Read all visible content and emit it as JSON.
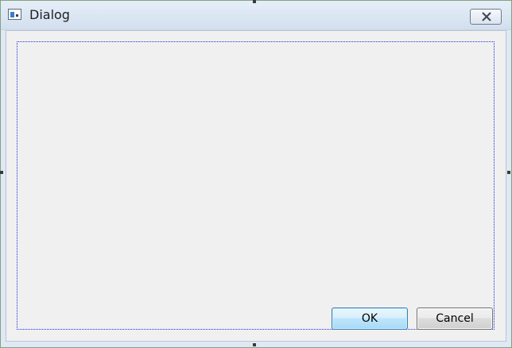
{
  "window": {
    "title": "Dialog"
  },
  "buttons": {
    "ok_label": "OK",
    "cancel_label": "Cancel"
  },
  "icons": {
    "app": "window-app-icon",
    "close": "close-icon"
  },
  "colors": {
    "layout_border": "#2030e0",
    "client_background": "#f0f0f0",
    "titlebar": "#dbe6f3"
  }
}
